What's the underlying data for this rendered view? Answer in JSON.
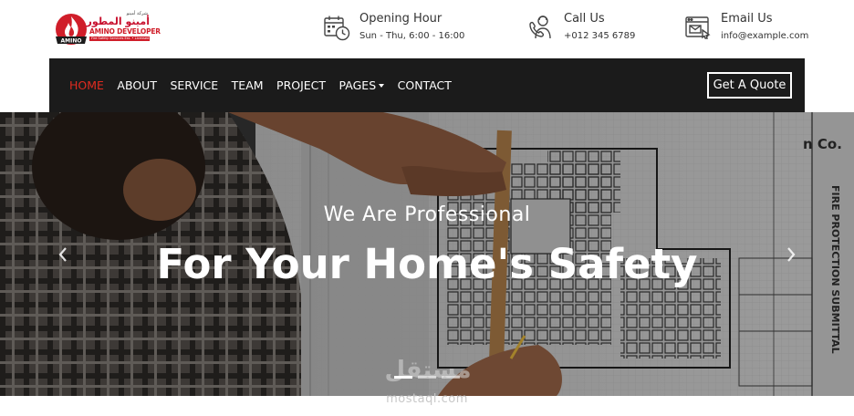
{
  "brand": {
    "arabic_name": "أمينو المطور",
    "arabic_small": "شركة أمينو",
    "english_name": "AMINO DEVELOPER",
    "tagline": "Fire Safety Services Est. • Licensed Agency",
    "badge_text": "AMINO",
    "color": "#d01e2a"
  },
  "contact_info": [
    {
      "icon": "calendar-clock-icon",
      "title": "Opening Hour",
      "value": "Sun - Thu, 6:00 - 16:00"
    },
    {
      "icon": "phone-agent-icon",
      "title": "Call Us",
      "value": "+012 345 6789"
    },
    {
      "icon": "email-window-icon",
      "title": "Email Us",
      "value": "info@example.com"
    }
  ],
  "nav": {
    "items": [
      {
        "label": "HOME",
        "active": true
      },
      {
        "label": "ABOUT",
        "active": false
      },
      {
        "label": "SERVICE",
        "active": false
      },
      {
        "label": "TEAM",
        "active": false
      },
      {
        "label": "PROJECT",
        "active": false
      },
      {
        "label": "PAGES",
        "active": false,
        "dropdown": true
      },
      {
        "label": "CONTACT",
        "active": false
      }
    ],
    "cta_label": "Get A Quote",
    "active_color": "#e02b20",
    "background": "#1b1b1b"
  },
  "hero": {
    "subtitle": "We Are Professional",
    "title": "For Your Home's Safety",
    "slides_count": 3,
    "active_slide": 1,
    "prev_icon": "chevron-left-icon",
    "next_icon": "chevron-right-icon",
    "blueprint_text_1": "FIRE PROTECTION SUBMITTAL",
    "blueprint_text_2": "n Co."
  },
  "watermark": {
    "arabic": "مستقل",
    "english": "mostaql.com"
  }
}
